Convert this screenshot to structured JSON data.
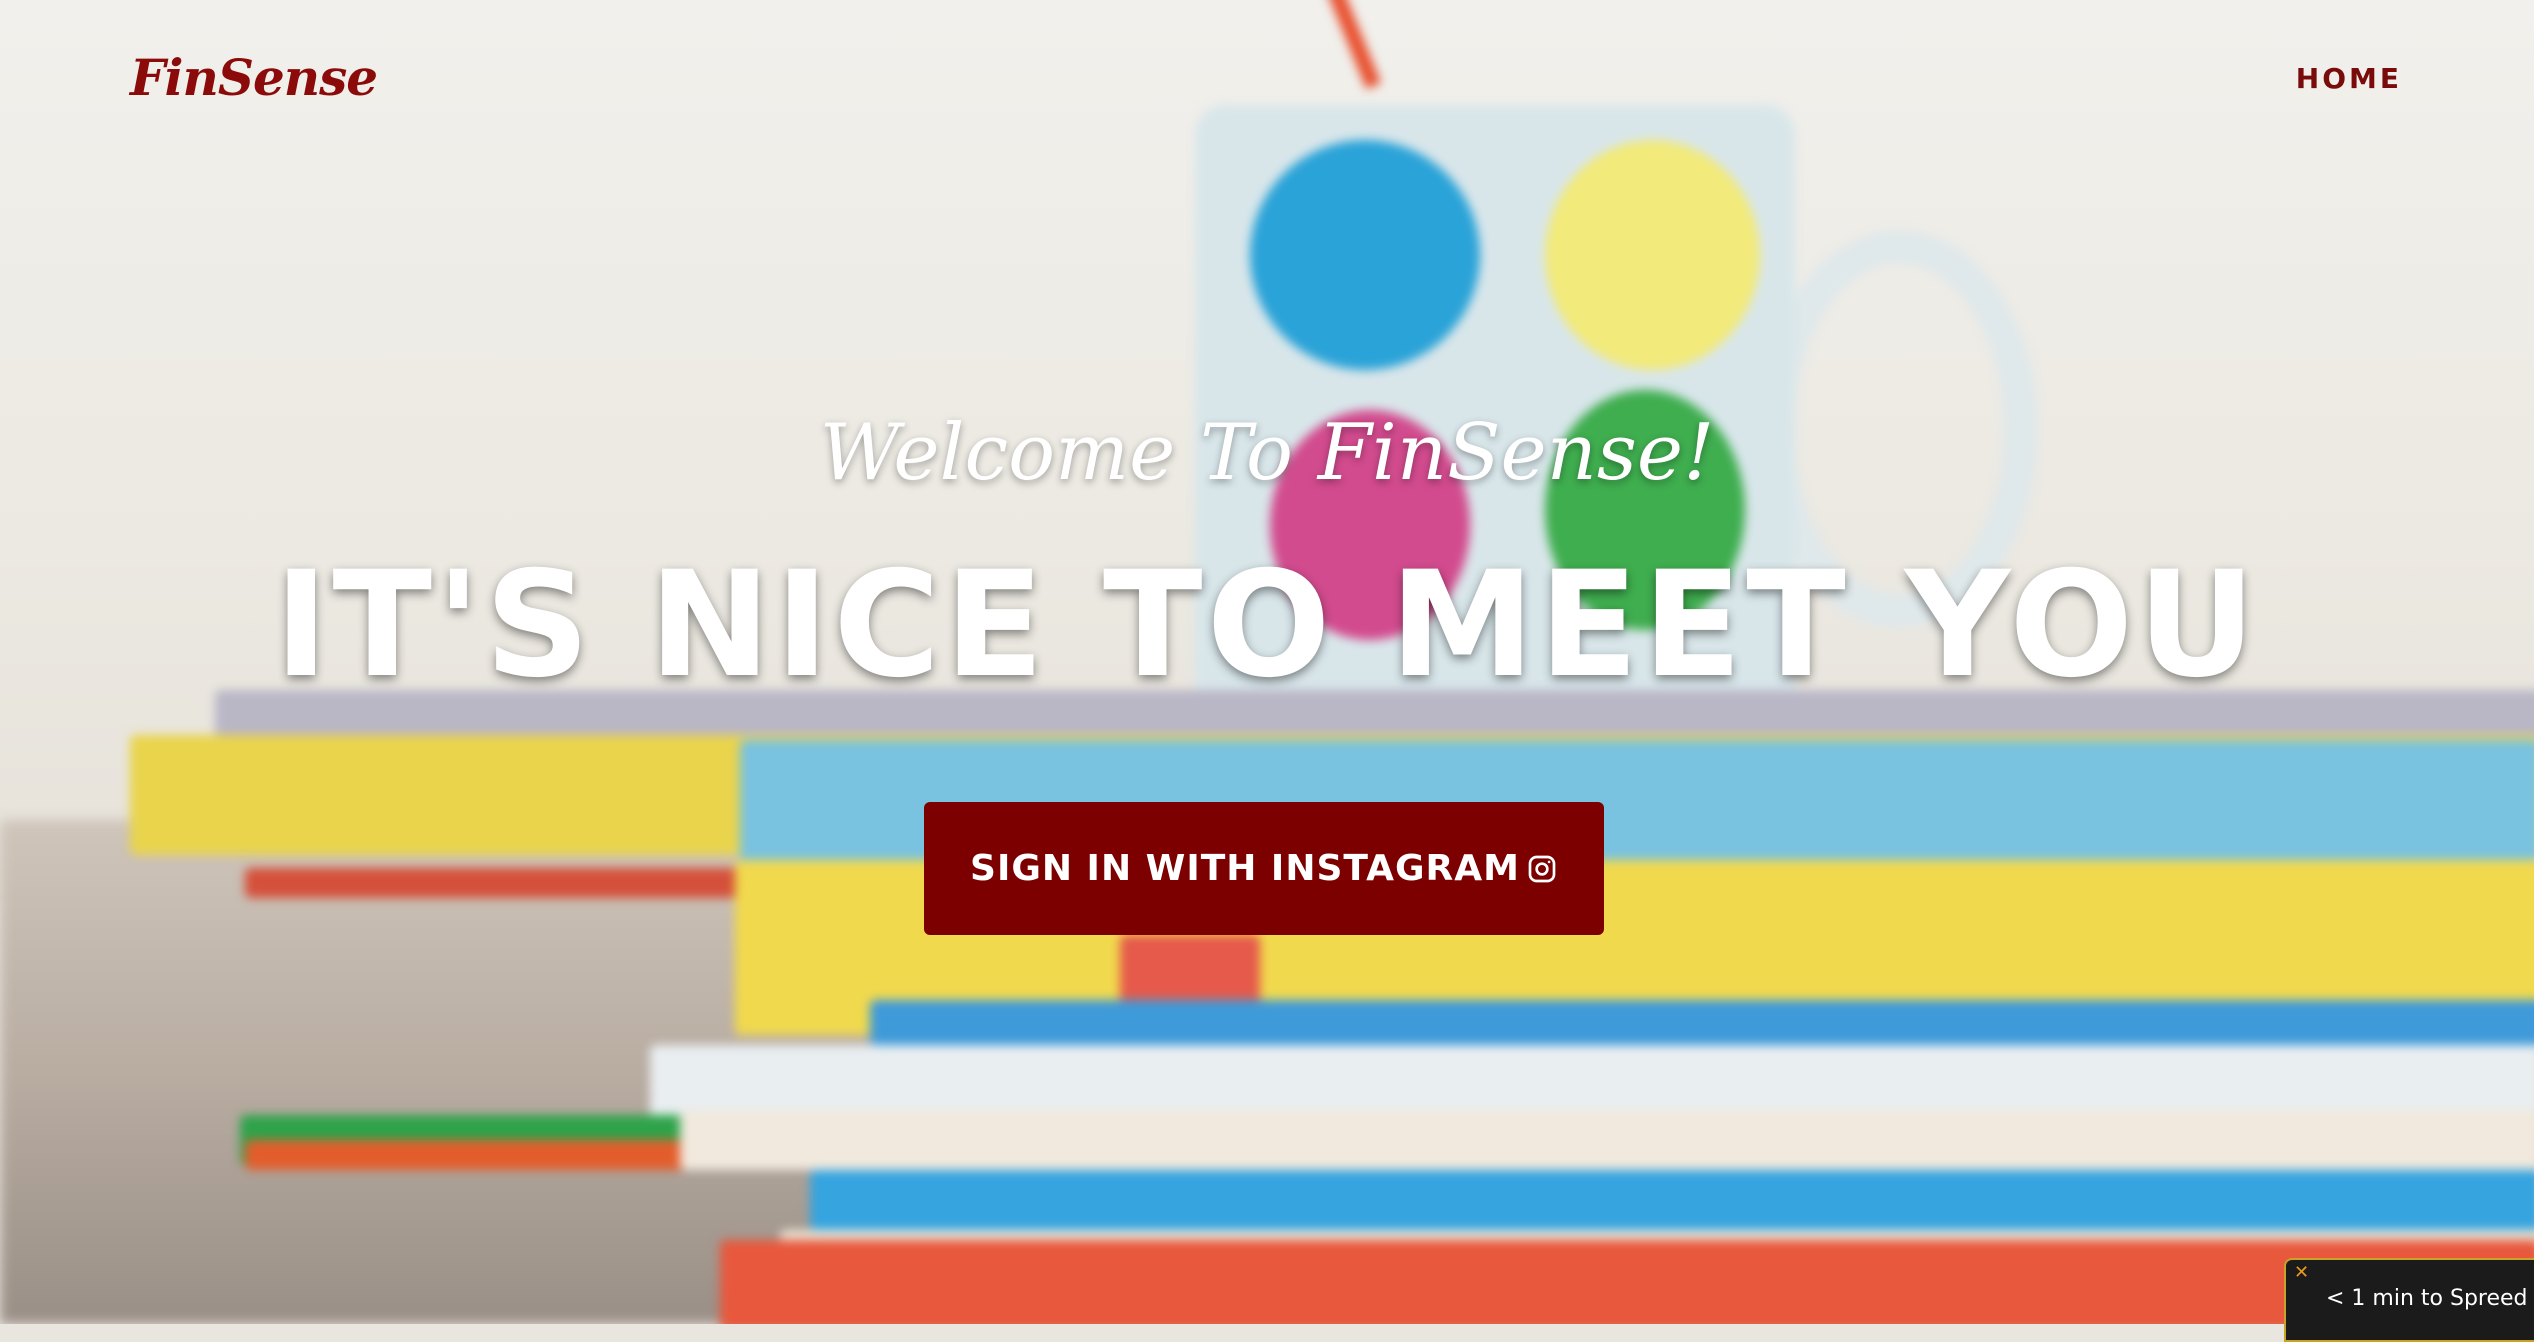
{
  "header": {
    "brand": "FinSense",
    "nav": [
      {
        "label": "HOME"
      }
    ]
  },
  "hero": {
    "welcome": "Welcome To FinSense!",
    "headline": "IT'S NICE TO MEET YOU",
    "cta_label": "SIGN IN WITH INSTAGRAM"
  },
  "toast": {
    "close": "✕",
    "text": "< 1 min to Spreed"
  },
  "colors": {
    "brand": "#8b0b0b",
    "cta_background": "#7d0000",
    "hero_text": "#ffffff",
    "toast_background": "#1b1b1b",
    "toast_border": "#c9a227"
  },
  "icons": {
    "cta": "instagram-icon",
    "toast": "close-icon"
  },
  "background": {
    "image": "blurred mug on a stack of children's books"
  }
}
